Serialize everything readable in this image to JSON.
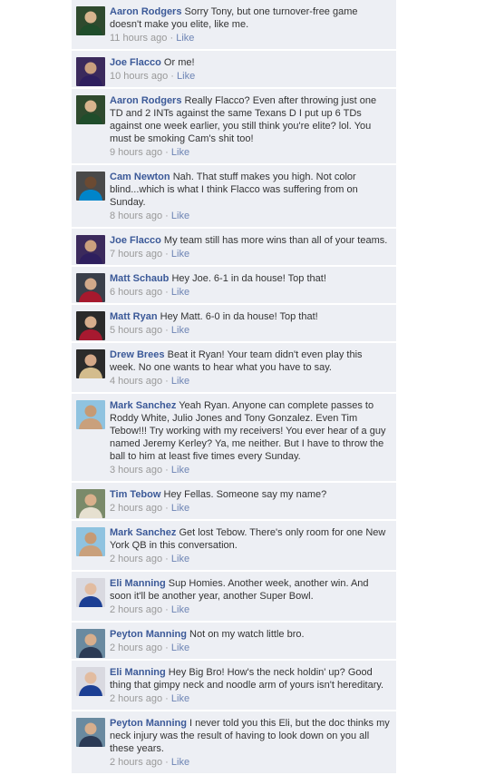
{
  "like_label": "Like",
  "separator": "·",
  "comments": [
    {
      "author": "Aaron Rodgers",
      "text": "Sorry Tony, but one turnover-free game doesn't make you elite, like me.",
      "time": "11 hours ago",
      "avatar": {
        "bg": "#2f4a2e",
        "jersey": "#1f4d2b",
        "skin": "#d8b48e"
      }
    },
    {
      "author": "Joe Flacco",
      "text": "Or me!",
      "time": "10 hours ago",
      "avatar": {
        "bg": "#3b2a5c",
        "jersey": "#2e1f5e",
        "skin": "#caa07e"
      }
    },
    {
      "author": "Aaron Rodgers",
      "text": "Really Flacco? Even after throwing just one TD and 2 INTs against the same Texans D I put up 6 TDs against one week earlier, you still think you're elite? lol. You must be smoking Cam's shit too!",
      "time": "9 hours ago",
      "avatar": {
        "bg": "#2f4a2e",
        "jersey": "#1f4d2b",
        "skin": "#d8b48e"
      }
    },
    {
      "author": "Cam Newton",
      "text": "Nah. That stuff makes you high. Not color blind...which is what I think Flacco was suffering from on Sunday.",
      "time": "8 hours ago",
      "avatar": {
        "bg": "#4a4a4a",
        "jersey": "#0085ca",
        "skin": "#6b4a32"
      }
    },
    {
      "author": "Joe Flacco",
      "text": "My team still has more wins than all of your teams.",
      "time": "7 hours ago",
      "avatar": {
        "bg": "#3b2a5c",
        "jersey": "#2e1f5e",
        "skin": "#caa07e"
      }
    },
    {
      "author": "Matt Schaub",
      "text": "Hey Joe. 6-1 in da house! Top that!",
      "time": "6 hours ago",
      "avatar": {
        "bg": "#3a3f4a",
        "jersey": "#a6192e",
        "skin": "#d2a98a"
      }
    },
    {
      "author": "Matt Ryan",
      "text": "Hey Matt. 6-0 in da house! Top that!",
      "time": "5 hours ago",
      "avatar": {
        "bg": "#2a2a2a",
        "jersey": "#a71930",
        "skin": "#d6ad8c"
      }
    },
    {
      "author": "Drew Brees",
      "text": "Beat it Ryan! Your team didn't even play this week. No one wants to hear what you have to say.",
      "time": "4 hours ago",
      "avatar": {
        "bg": "#2b2b2b",
        "jersey": "#d3bc8d",
        "skin": "#d4a888"
      }
    },
    {
      "author": "Mark Sanchez",
      "text": "Yeah Ryan. Anyone can complete passes to Roddy White, Julio Jones and Tony Gonzalez. Even Tim Tebow!!! Try working with my receivers! You ever hear of a guy named Jeremy Kerley? Ya, me neither. But I have to throw the ball to him at least five times every Sunday.",
      "time": "3 hours ago",
      "avatar": {
        "bg": "#8fc3e0",
        "jersey": "#c9a07c",
        "skin": "#c69a74"
      }
    },
    {
      "author": "Tim Tebow",
      "text": "Hey Fellas. Someone say my name?",
      "time": "2 hours ago",
      "avatar": {
        "bg": "#7a8a6a",
        "jersey": "#e6e0d0",
        "skin": "#d9b08c"
      }
    },
    {
      "author": "Mark Sanchez",
      "text": "Get lost Tebow. There's only room for one New York QB in this conversation.",
      "time": "2 hours ago",
      "avatar": {
        "bg": "#8fc3e0",
        "jersey": "#c9a07c",
        "skin": "#c69a74"
      }
    },
    {
      "author": "Eli Manning",
      "text": "Sup Homies. Another week, another win. And soon it'll be another year, another Super Bowl.",
      "time": "2 hours ago",
      "avatar": {
        "bg": "#d9d9e0",
        "jersey": "#1c3f94",
        "skin": "#e2bca0"
      }
    },
    {
      "author": "Peyton Manning",
      "text": "Not on my watch little bro.",
      "time": "2 hours ago",
      "avatar": {
        "bg": "#6a8aa0",
        "jersey": "#2b3a55",
        "skin": "#d8ae8c"
      }
    },
    {
      "author": "Eli Manning",
      "text": "Hey Big Bro! How's the neck holdin' up? Good thing that gimpy neck and noodle arm of yours isn't hereditary.",
      "time": "2 hours ago",
      "avatar": {
        "bg": "#d9d9e0",
        "jersey": "#1c3f94",
        "skin": "#e2bca0"
      }
    },
    {
      "author": "Peyton Manning",
      "text": "I never told you this Eli, but the doc thinks my neck injury was the result of having to look down on you all these years.",
      "time": "2 hours ago",
      "avatar": {
        "bg": "#6a8aa0",
        "jersey": "#2b3a55",
        "skin": "#d8ae8c"
      }
    }
  ]
}
